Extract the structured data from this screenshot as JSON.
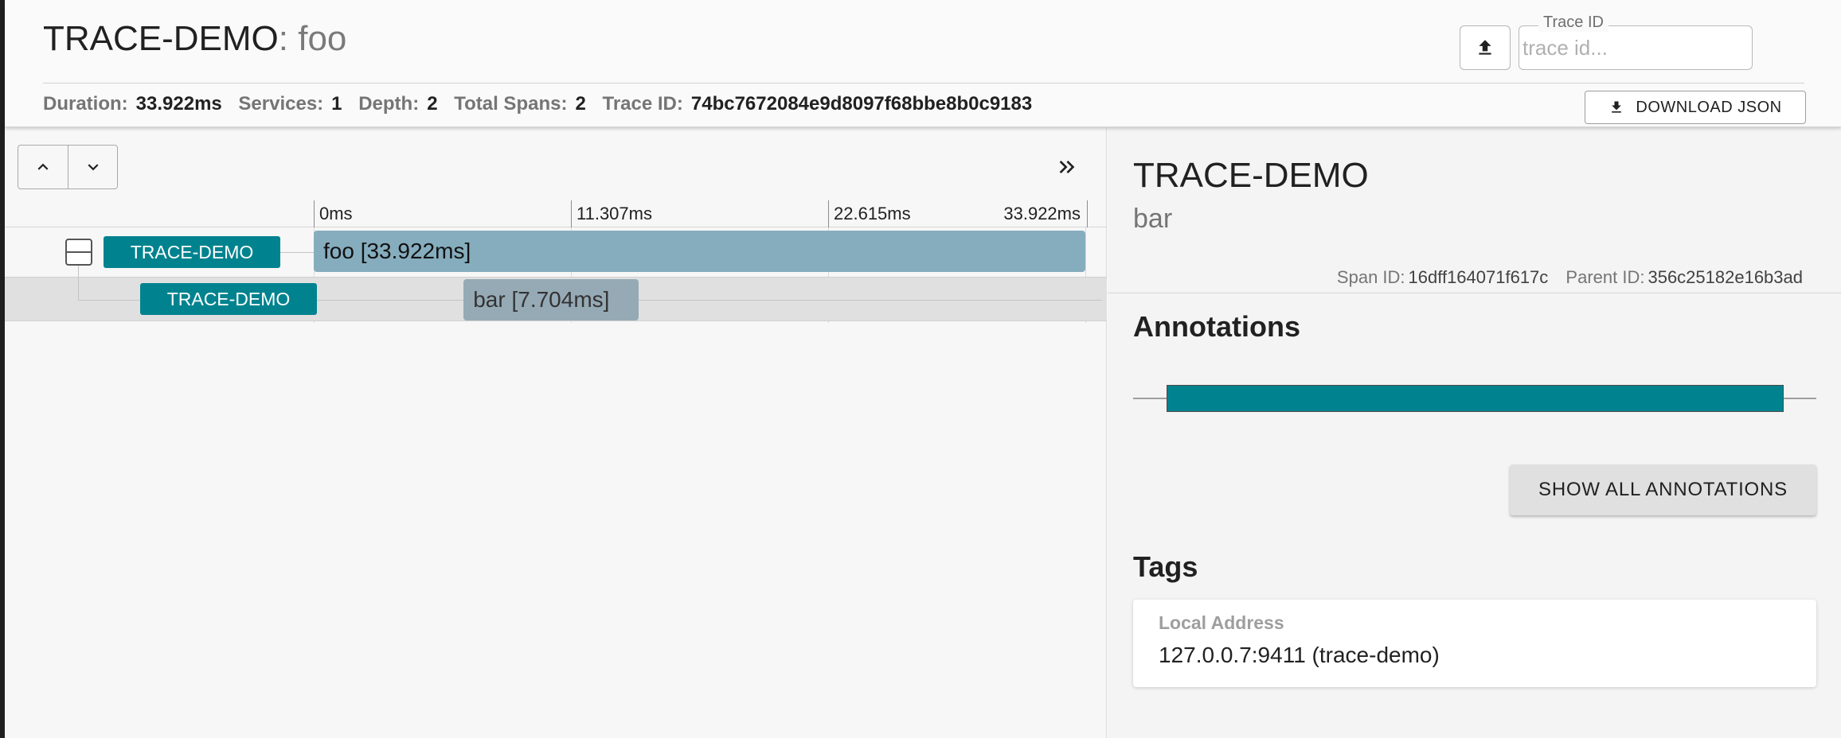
{
  "header": {
    "service_name": "TRACE-DEMO",
    "span_name": ": foo",
    "trace_id_field": {
      "label": "Trace ID",
      "placeholder": "trace id...",
      "value": ""
    },
    "stats": {
      "duration_label": "Duration:",
      "duration": "33.922ms",
      "services_label": "Services:",
      "services": "1",
      "depth_label": "Depth:",
      "depth": "2",
      "total_spans_label": "Total Spans:",
      "total_spans": "2",
      "trace_id_label": "Trace ID:",
      "trace_id": "74bc7672084e9d8097f68bbe8b0c9183"
    },
    "download_label": "DOWNLOAD JSON",
    "icons": {
      "upload": "upload-icon",
      "download": "download-icon"
    }
  },
  "timeline": {
    "ticks": [
      "0ms",
      "11.307ms",
      "22.615ms",
      "33.922ms"
    ],
    "total_duration_ms": 33.922,
    "spans": [
      {
        "service": "TRACE-DEMO",
        "label": "foo [33.922ms]",
        "start_ms": 0,
        "duration_ms": 33.922,
        "depth": 0,
        "selected": false
      },
      {
        "service": "TRACE-DEMO",
        "label": "bar [7.704ms]",
        "start_ms": 6.59,
        "duration_ms": 7.704,
        "depth": 1,
        "selected": true
      }
    ],
    "icons": {
      "prev": "chevron-up-icon",
      "next": "chevron-down-icon",
      "expand": "double-chevron-right-icon",
      "collapse": "collapse-icon"
    }
  },
  "detail": {
    "service_name": "TRACE-DEMO",
    "span_name": "bar",
    "span_id_label": "Span ID:",
    "span_id": "16dff164071f617c",
    "parent_id_label": "Parent ID:",
    "parent_id": "356c25182e16b3ad",
    "annotations_title": "Annotations",
    "show_all_label": "SHOW ALL ANNOTATIONS",
    "tags_title": "Tags",
    "tags": [
      {
        "key": "Local Address",
        "value": "127.0.0.7:9411 (trace-demo)"
      }
    ]
  },
  "colors": {
    "service_badge": "#00838f",
    "annotation_bar": "#00838f",
    "foo_bar": "#86adbe",
    "bar_bar": "#96aab6"
  }
}
